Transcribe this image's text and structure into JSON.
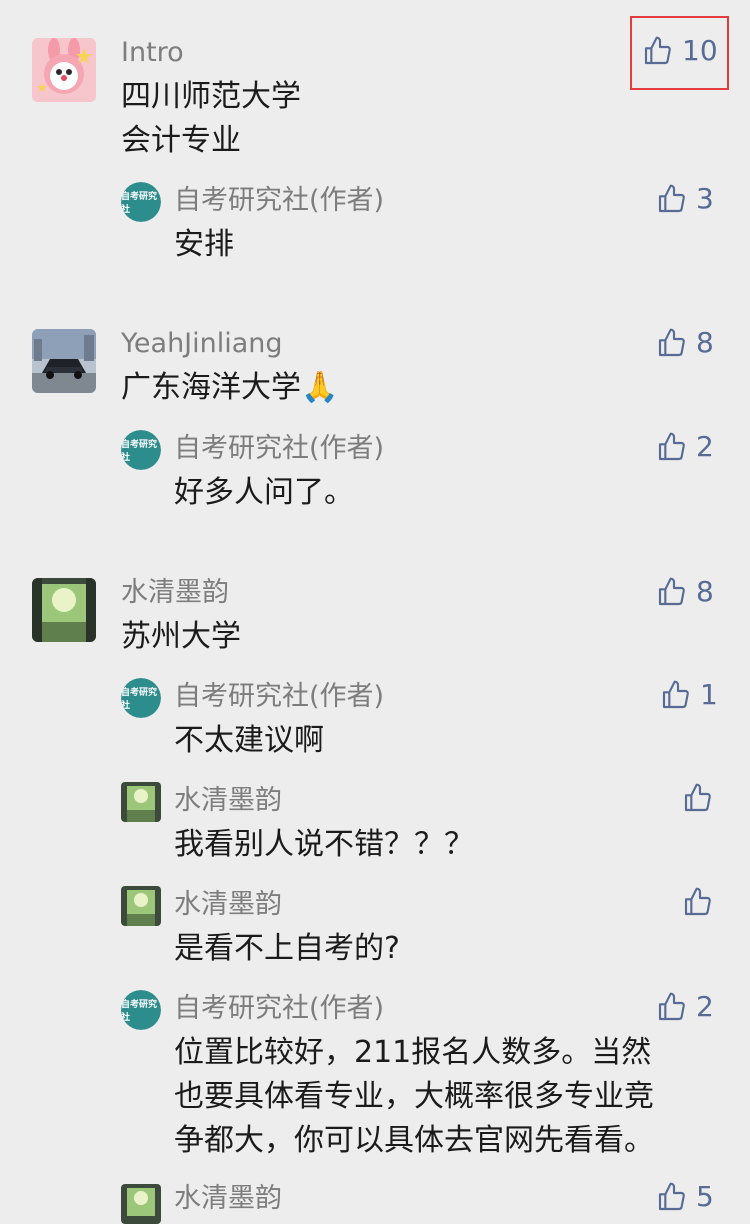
{
  "colors": {
    "accent": "#576b95",
    "highlight": "#e23c3c"
  },
  "comments": [
    {
      "name": "Intro",
      "text_lines": [
        "四川师范大学",
        "会计专业"
      ],
      "likes": "10",
      "replies": [
        {
          "name": "自考研究社(作者)",
          "text": "安排",
          "likes": "3"
        }
      ]
    },
    {
      "name": "YeahJinliang",
      "text_lines": [
        "广东海洋大学🙏"
      ],
      "likes": "8",
      "replies": [
        {
          "name": "自考研究社(作者)",
          "text": "好多人问了。",
          "likes": "2"
        }
      ]
    },
    {
      "name": "水清墨韵",
      "text_lines": [
        "苏州大学"
      ],
      "likes": "8",
      "replies": [
        {
          "name": "自考研究社(作者)",
          "text": "不太建议啊",
          "likes": "1"
        },
        {
          "name": "水清墨韵",
          "text": "我看别人说不错？？？",
          "likes": ""
        },
        {
          "name": "水清墨韵",
          "text": "是看不上自考的?",
          "likes": ""
        },
        {
          "name": "自考研究社(作者)",
          "text_lines": [
            "位置比较好，211报名人数多。当然",
            "也要具体看专业，大概率很多专业竞",
            "争都大，你可以具体去官网先看看。"
          ],
          "likes": "2"
        },
        {
          "name": "水清墨韵",
          "text": "",
          "likes": "5"
        }
      ]
    }
  ],
  "avatar_label": "自考研究社"
}
